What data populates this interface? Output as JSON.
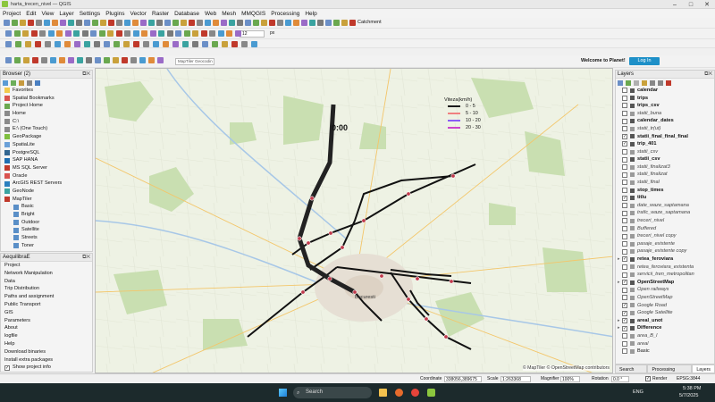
{
  "window": {
    "title": "harta_trecen_nivel — QGIS"
  },
  "menu": [
    "Project",
    "Edit",
    "View",
    "Layer",
    "Settings",
    "Plugins",
    "Vector",
    "Raster",
    "Database",
    "Web",
    "Mesh",
    "MMQGIS",
    "Processing",
    "Help"
  ],
  "toolbar": {
    "catchment": "Catchment",
    "scale_small": "12",
    "unit": "px",
    "maptiler_placeholder": "MapTiler Geocodin",
    "planet_welcome": "Welcome to Planet!",
    "planet_login": "Log In"
  },
  "browser": {
    "title": "Browser (2)",
    "items": [
      "Favorites",
      "Spatial Bookmarks",
      "Project Home",
      "Home",
      "C:\\",
      "E:\\ (One Touch)",
      "GeoPackage",
      "SpatiaLite",
      "PostgreSQL",
      "SAP HANA",
      "MS SQL Server",
      "Oracle",
      "ArcGIS REST Servers",
      "GeoNode",
      "MapTiler",
      "Basic",
      "Bright",
      "Outdoor",
      "Satellite",
      "Streets",
      "Toner"
    ]
  },
  "aequilibrae": {
    "title": "AequilibraE",
    "items": [
      "Project",
      "Network Manipulation",
      "Data",
      "Trip Distribution",
      "Paths and assignment",
      "Public Transport",
      "GIS",
      "Parameters",
      "About",
      "logfile",
      "Help",
      "Download binaries",
      "Install extra packages"
    ],
    "show_project_info": "Show project info"
  },
  "locator": {
    "placeholder": "Type to locate (Ctrl+K)"
  },
  "layers": {
    "title": "Layers",
    "items": [
      {
        "label": "calendar",
        "style": "bold"
      },
      {
        "label": "trips",
        "style": "bold"
      },
      {
        "label": "trips_csv",
        "style": "bold"
      },
      {
        "label": "statii_buna",
        "style": "ital"
      },
      {
        "label": "calendar_dates",
        "style": "bold"
      },
      {
        "label": "statii_tr(ut)",
        "style": "ital"
      },
      {
        "label": "statii_final_final_final",
        "style": "bold"
      },
      {
        "label": "trip_401",
        "style": "bold"
      },
      {
        "label": "statii_csv",
        "style": "ital"
      },
      {
        "label": "statii_csv",
        "style": "bold"
      },
      {
        "label": "statii_finalizat3",
        "style": "ital"
      },
      {
        "label": "statii_finalizat",
        "style": "ital"
      },
      {
        "label": "statii_final",
        "style": "ital"
      },
      {
        "label": "stop_times",
        "style": "bold"
      },
      {
        "label": "titlu",
        "style": "bold"
      },
      {
        "label": "date_waze_saptamana",
        "style": "ital"
      },
      {
        "label": "trafic_waze_saptamana",
        "style": "ital"
      },
      {
        "label": "treceri_nivel",
        "style": "ital"
      },
      {
        "label": "Buffered",
        "style": "ital"
      },
      {
        "label": "treceri_nivel copy",
        "style": "ital"
      },
      {
        "label": "pasaje_existente",
        "style": "ital"
      },
      {
        "label": "pasaje_existente copy",
        "style": "ital"
      },
      {
        "label": "retea_feroviara",
        "style": "bold"
      },
      {
        "label": "retea_feroviara_existenta",
        "style": "ital"
      },
      {
        "label": "servicii_tren_metropolitan",
        "style": "ital"
      },
      {
        "label": "OpenStreetMap",
        "style": "bold"
      },
      {
        "label": "Open railways",
        "style": "ital"
      },
      {
        "label": "OpenStreetMap",
        "style": "ital"
      },
      {
        "label": "Google Road",
        "style": "ital"
      },
      {
        "label": "Google Satellite",
        "style": "ital"
      },
      {
        "label": "areal_unot",
        "style": "bold"
      },
      {
        "label": "Difference",
        "style": "bold"
      },
      {
        "label": "area_B_l",
        "style": "ital"
      },
      {
        "label": "areal",
        "style": "ital"
      },
      {
        "label": "Basic",
        "style": "normal"
      }
    ],
    "tabs": [
      "Search QMS",
      "Processing Toolbox",
      "Layers"
    ]
  },
  "map": {
    "time_label": "0:00",
    "city_label": "Bucuresti",
    "attribution": "© MapTiler  © OpenStreetMap contributors",
    "legend": {
      "title": "Viteza(km/h)",
      "entries": [
        {
          "label": "0 - 5",
          "color": "#1a1a1a"
        },
        {
          "label": "5 - 10",
          "color": "#f08080"
        },
        {
          "label": "10 - 20",
          "color": "#8a5cf5"
        },
        {
          "label": "20 - 30",
          "color": "#cc44cc"
        }
      ]
    }
  },
  "status": {
    "coordinate_label": "Coordinate",
    "coordinate": "338056,389675",
    "scale_label": "Scale",
    "scale": "1:263368",
    "magnifier_label": "Magnifier",
    "magnifier": "100%",
    "rotation_label": "Rotation",
    "rotation": "0.0 °",
    "render_label": "Render",
    "crs": "EPSG:3844"
  },
  "taskbar": {
    "search": "Search",
    "lang": "ENG",
    "time": "5:38 PM",
    "date": "5/7/2025"
  }
}
